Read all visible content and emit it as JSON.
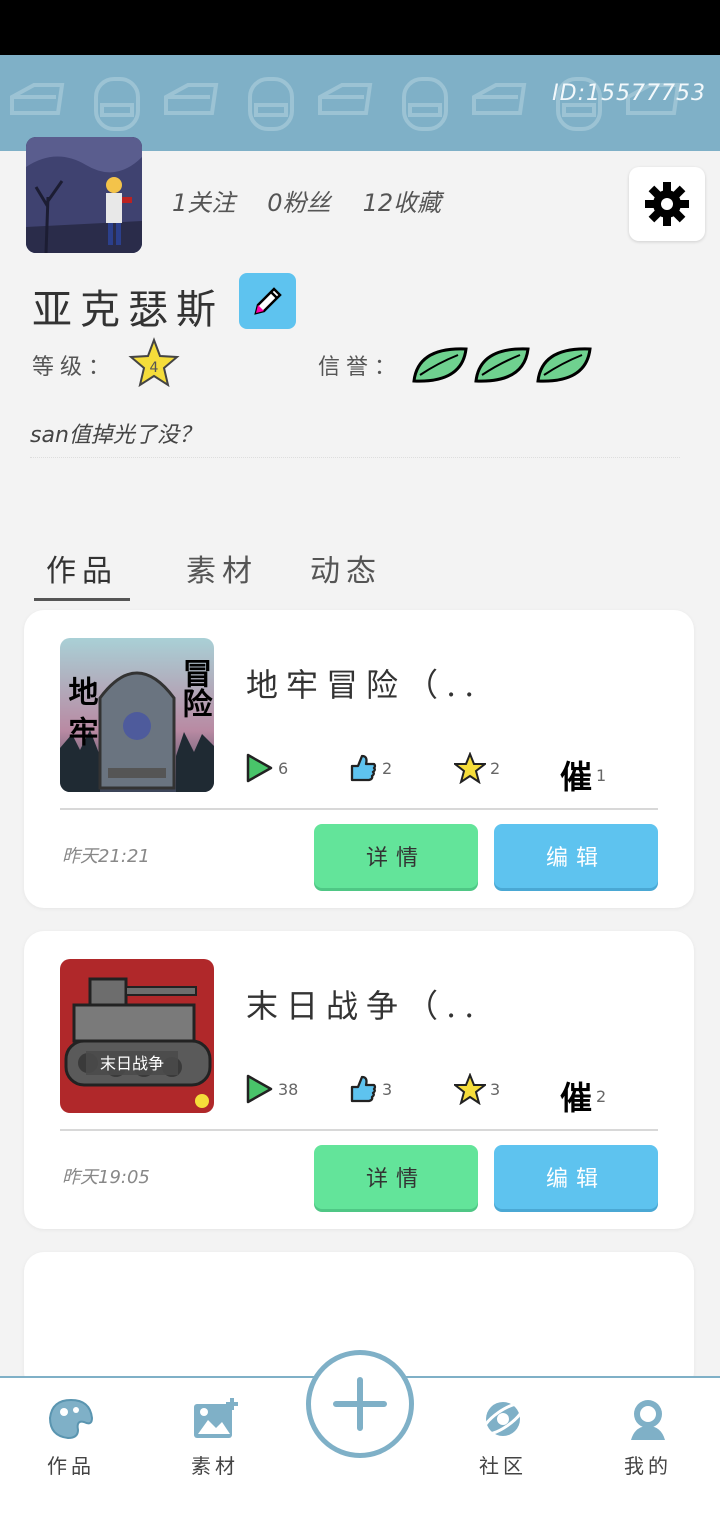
{
  "header": {
    "user_id": "ID:15577753"
  },
  "profile": {
    "following": "1关注",
    "fans": "0粉丝",
    "favorites": "12收藏",
    "name": "亚克瑟斯",
    "level_label": "等级：",
    "level_value": "4",
    "credit_label": "信誉：",
    "credit_leaves": 3,
    "bio": "san值掉光了没？"
  },
  "tabs": [
    {
      "label": "作品",
      "active": true
    },
    {
      "label": "素材",
      "active": false
    },
    {
      "label": "动态",
      "active": false
    }
  ],
  "works": [
    {
      "title": "地牢冒险（..",
      "thumb_text_left": "地牢",
      "thumb_text_right": "冒险",
      "plays": "6",
      "likes": "2",
      "stars": "2",
      "urge_label": "催",
      "urges": "1",
      "time": "昨天21:21",
      "detail_label": "详情",
      "edit_label": "编辑"
    },
    {
      "title": "末日战争（..",
      "thumb_text": "末日战争",
      "plays": "38",
      "likes": "3",
      "stars": "3",
      "urge_label": "催",
      "urges": "2",
      "time": "昨天19:05",
      "detail_label": "详情",
      "edit_label": "编辑"
    }
  ],
  "nav": {
    "works": "作品",
    "assets": "素材",
    "community": "社区",
    "mine": "我的"
  },
  "colors": {
    "accent": "#7fb0c7",
    "detail_button": "#63e49a",
    "edit_button": "#5ec3ef",
    "leaf": "#6fd18f",
    "star": "#f5dd3a"
  }
}
